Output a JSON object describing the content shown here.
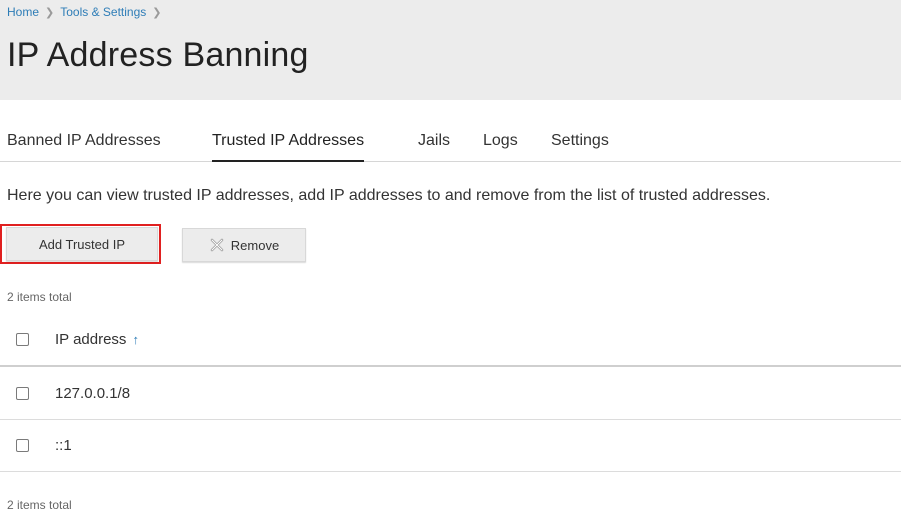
{
  "breadcrumb": {
    "items": [
      "Home",
      "Tools & Settings"
    ]
  },
  "page": {
    "title": "IP Address Banning"
  },
  "tabs": [
    {
      "label": "Banned IP Addresses"
    },
    {
      "label": "Trusted IP Addresses",
      "active": true
    },
    {
      "label": "Jails"
    },
    {
      "label": "Logs"
    },
    {
      "label": "Settings"
    }
  ],
  "description": "Here you can view trusted IP addresses, add IP addresses to and remove from the list of trusted addresses.",
  "toolbar": {
    "add_label": "Add Trusted IP",
    "remove_label": "Remove"
  },
  "list": {
    "count_top": "2 items total",
    "count_bottom": "2 items total",
    "column_header": "IP address",
    "sort_icon": "↑",
    "rows": [
      {
        "ip": "127.0.0.1/8"
      },
      {
        "ip": "::1"
      }
    ]
  },
  "colors": {
    "link": "#2e7db7",
    "highlight": "#e02020",
    "header_bg": "#ececec"
  }
}
